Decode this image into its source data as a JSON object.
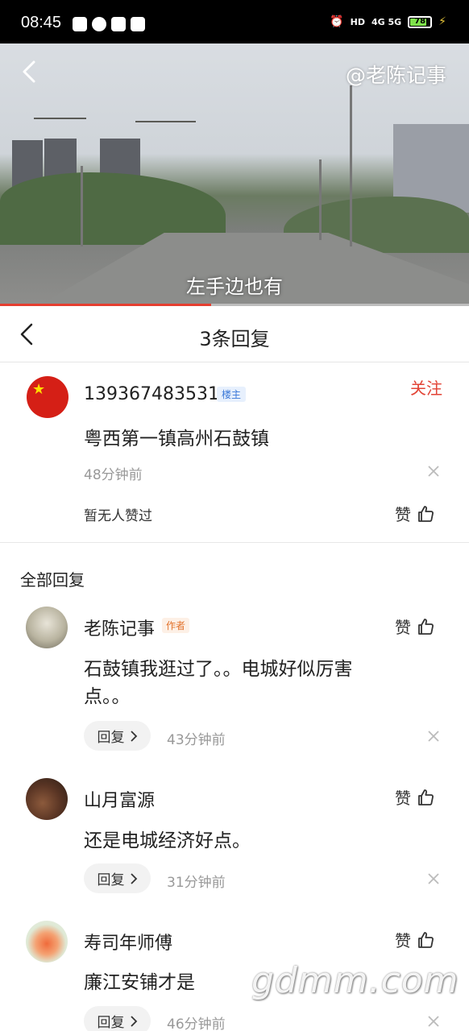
{
  "status_bar": {
    "time": "08:45",
    "battery": "78",
    "network": "4G 5G"
  },
  "video": {
    "watermark": "@老陈记事",
    "subtitle": "左手边也有",
    "progress": 0.45
  },
  "header": {
    "title": "3条回复"
  },
  "main_comment": {
    "username": "139367483531",
    "badge": "楼主",
    "follow": "关注",
    "text": "粤西第一镇高州石鼓镇",
    "time": "48分钟前",
    "likes_text": "暂无人赞过",
    "like_label": "赞"
  },
  "replies_section": {
    "title": "全部回复"
  },
  "replies": [
    {
      "username": "老陈记事",
      "badge": "作者",
      "text_line1": "石鼓镇我逛过了。。电城好似厉害",
      "text_line2": "点。。",
      "reply_label": "回复",
      "time": "43分钟前",
      "like_label": "赞"
    },
    {
      "username": "山月富源",
      "text": "还是电城经济好点。",
      "reply_label": "回复",
      "time": "31分钟前",
      "like_label": "赞"
    },
    {
      "username": "寿司年师傅",
      "text": "廉江安铺才是",
      "reply_label": "回复",
      "time": "46分钟前",
      "like_label": "赞"
    }
  ],
  "site_watermark": "gdmm.com",
  "colors": {
    "accent_red": "#e24335",
    "host_badge": "#3a78d8",
    "author_badge": "#e2732d"
  }
}
